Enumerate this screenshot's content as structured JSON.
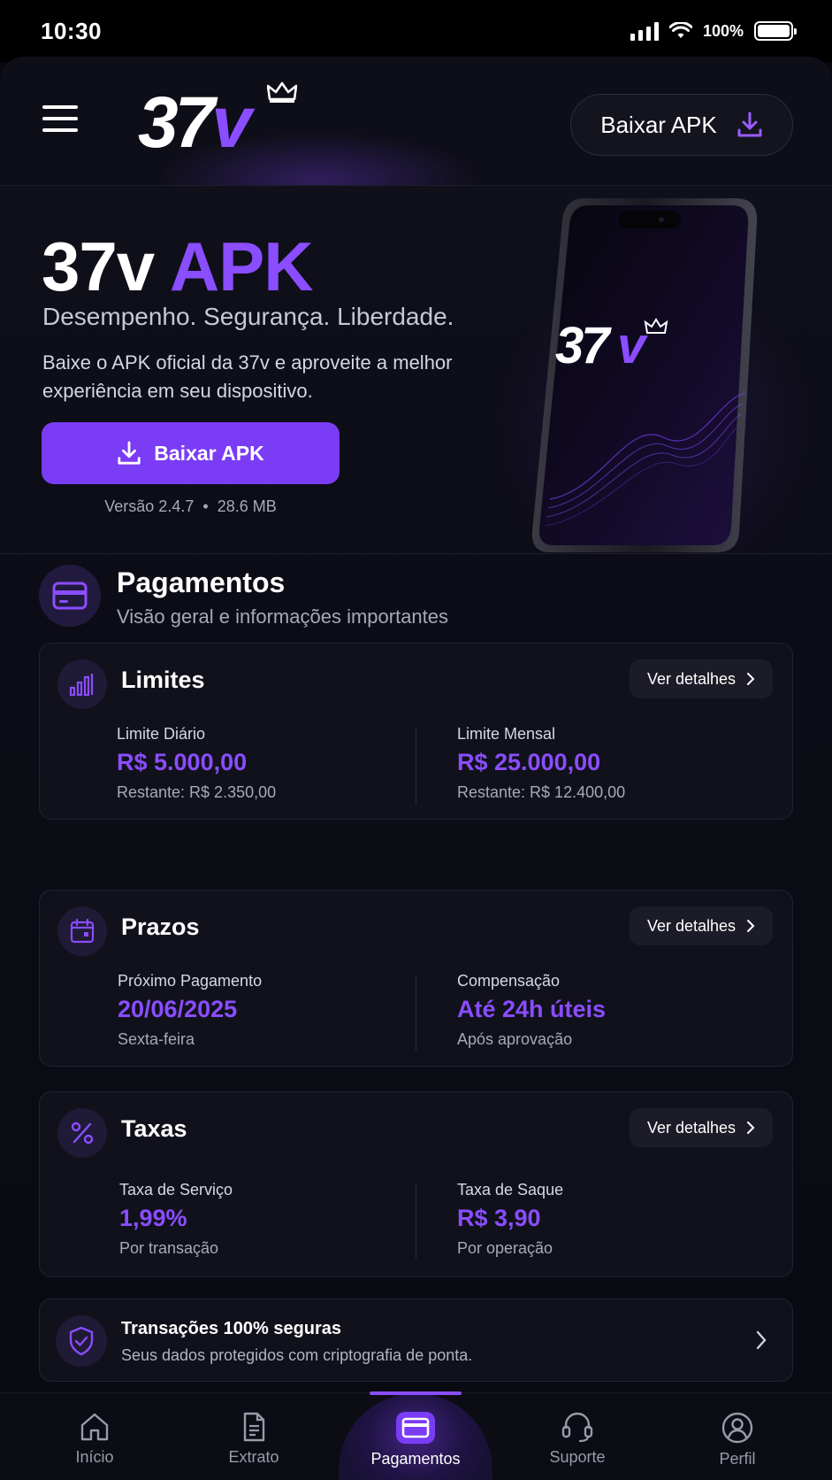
{
  "status_bar": {
    "time": "10:30",
    "battery": "100%"
  },
  "header": {
    "logo_text_num": "37",
    "logo_text_v": "v",
    "apk_button_label": "Baixar APK"
  },
  "hero": {
    "title_main": "37v",
    "title_accent": "APK",
    "subtitle": "Desempenho. Segurança. Liberdade.",
    "description": "Baixe o APK oficial da 37v e aproveite a melhor experiência em seu dispositivo.",
    "button_label": "Baixar APK",
    "version": "Versão 2.4.7",
    "separator": "•",
    "size": "28.6 MB",
    "phone_logo_num": "37",
    "phone_logo_v": "v"
  },
  "payments": {
    "title": "Pagamentos",
    "subtitle": "Visão geral e informações importantes",
    "detail_label": "Ver detalhes",
    "cards": [
      {
        "title": "Limites",
        "icon": "bar-chart-icon",
        "left": {
          "label": "Limite Diário",
          "value": "R$ 5.000,00",
          "note": "Restante: R$ 2.350,00"
        },
        "right": {
          "label": "Limite Mensal",
          "value": "R$ 25.000,00",
          "note": "Restante: R$ 12.400,00"
        }
      },
      {
        "title": "Prazos",
        "icon": "calendar-icon",
        "left": {
          "label": "Próximo Pagamento",
          "value": "20/06/2025",
          "note": "Sexta-feira"
        },
        "right": {
          "label": "Compensação",
          "value": "Até 24h úteis",
          "note": "Após aprovação"
        }
      },
      {
        "title": "Taxas",
        "icon": "percent-icon",
        "left": {
          "label": "Taxa de Serviço",
          "value": "1,99%",
          "note": "Por transação"
        },
        "right": {
          "label": "Taxa de Saque",
          "value": "R$ 3,90",
          "note": "Por operação"
        }
      }
    ],
    "secure": {
      "title": "Transações 100% seguras",
      "subtitle": "Seus dados protegidos com criptografia de ponta."
    }
  },
  "bottom_nav": [
    {
      "label": "Início",
      "icon": "home-icon"
    },
    {
      "label": "Extrato",
      "icon": "document-icon"
    },
    {
      "label": "Pagamentos",
      "icon": "card-icon",
      "active": true
    },
    {
      "label": "Suporte",
      "icon": "headset-icon"
    },
    {
      "label": "Perfil",
      "icon": "user-icon"
    }
  ],
  "colors": {
    "accent": "#8a4dff",
    "button": "#7b3cf5",
    "background": "#0a0a12"
  }
}
